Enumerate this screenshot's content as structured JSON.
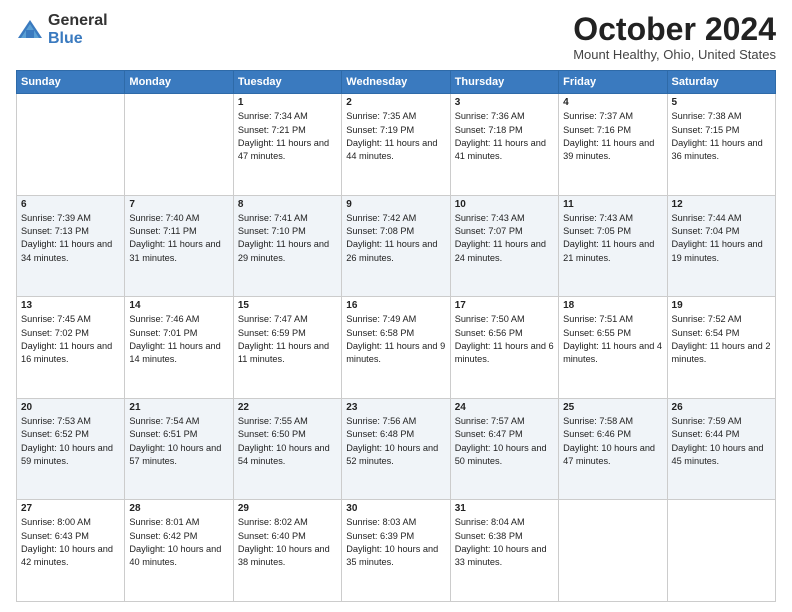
{
  "header": {
    "logo_general": "General",
    "logo_blue": "Blue",
    "title": "October 2024",
    "subtitle": "Mount Healthy, Ohio, United States"
  },
  "columns": [
    "Sunday",
    "Monday",
    "Tuesday",
    "Wednesday",
    "Thursday",
    "Friday",
    "Saturday"
  ],
  "weeks": [
    [
      {
        "day": "",
        "info": ""
      },
      {
        "day": "",
        "info": ""
      },
      {
        "day": "1",
        "info": "Sunrise: 7:34 AM\nSunset: 7:21 PM\nDaylight: 11 hours and 47 minutes."
      },
      {
        "day": "2",
        "info": "Sunrise: 7:35 AM\nSunset: 7:19 PM\nDaylight: 11 hours and 44 minutes."
      },
      {
        "day": "3",
        "info": "Sunrise: 7:36 AM\nSunset: 7:18 PM\nDaylight: 11 hours and 41 minutes."
      },
      {
        "day": "4",
        "info": "Sunrise: 7:37 AM\nSunset: 7:16 PM\nDaylight: 11 hours and 39 minutes."
      },
      {
        "day": "5",
        "info": "Sunrise: 7:38 AM\nSunset: 7:15 PM\nDaylight: 11 hours and 36 minutes."
      }
    ],
    [
      {
        "day": "6",
        "info": "Sunrise: 7:39 AM\nSunset: 7:13 PM\nDaylight: 11 hours and 34 minutes."
      },
      {
        "day": "7",
        "info": "Sunrise: 7:40 AM\nSunset: 7:11 PM\nDaylight: 11 hours and 31 minutes."
      },
      {
        "day": "8",
        "info": "Sunrise: 7:41 AM\nSunset: 7:10 PM\nDaylight: 11 hours and 29 minutes."
      },
      {
        "day": "9",
        "info": "Sunrise: 7:42 AM\nSunset: 7:08 PM\nDaylight: 11 hours and 26 minutes."
      },
      {
        "day": "10",
        "info": "Sunrise: 7:43 AM\nSunset: 7:07 PM\nDaylight: 11 hours and 24 minutes."
      },
      {
        "day": "11",
        "info": "Sunrise: 7:43 AM\nSunset: 7:05 PM\nDaylight: 11 hours and 21 minutes."
      },
      {
        "day": "12",
        "info": "Sunrise: 7:44 AM\nSunset: 7:04 PM\nDaylight: 11 hours and 19 minutes."
      }
    ],
    [
      {
        "day": "13",
        "info": "Sunrise: 7:45 AM\nSunset: 7:02 PM\nDaylight: 11 hours and 16 minutes."
      },
      {
        "day": "14",
        "info": "Sunrise: 7:46 AM\nSunset: 7:01 PM\nDaylight: 11 hours and 14 minutes."
      },
      {
        "day": "15",
        "info": "Sunrise: 7:47 AM\nSunset: 6:59 PM\nDaylight: 11 hours and 11 minutes."
      },
      {
        "day": "16",
        "info": "Sunrise: 7:49 AM\nSunset: 6:58 PM\nDaylight: 11 hours and 9 minutes."
      },
      {
        "day": "17",
        "info": "Sunrise: 7:50 AM\nSunset: 6:56 PM\nDaylight: 11 hours and 6 minutes."
      },
      {
        "day": "18",
        "info": "Sunrise: 7:51 AM\nSunset: 6:55 PM\nDaylight: 11 hours and 4 minutes."
      },
      {
        "day": "19",
        "info": "Sunrise: 7:52 AM\nSunset: 6:54 PM\nDaylight: 11 hours and 2 minutes."
      }
    ],
    [
      {
        "day": "20",
        "info": "Sunrise: 7:53 AM\nSunset: 6:52 PM\nDaylight: 10 hours and 59 minutes."
      },
      {
        "day": "21",
        "info": "Sunrise: 7:54 AM\nSunset: 6:51 PM\nDaylight: 10 hours and 57 minutes."
      },
      {
        "day": "22",
        "info": "Sunrise: 7:55 AM\nSunset: 6:50 PM\nDaylight: 10 hours and 54 minutes."
      },
      {
        "day": "23",
        "info": "Sunrise: 7:56 AM\nSunset: 6:48 PM\nDaylight: 10 hours and 52 minutes."
      },
      {
        "day": "24",
        "info": "Sunrise: 7:57 AM\nSunset: 6:47 PM\nDaylight: 10 hours and 50 minutes."
      },
      {
        "day": "25",
        "info": "Sunrise: 7:58 AM\nSunset: 6:46 PM\nDaylight: 10 hours and 47 minutes."
      },
      {
        "day": "26",
        "info": "Sunrise: 7:59 AM\nSunset: 6:44 PM\nDaylight: 10 hours and 45 minutes."
      }
    ],
    [
      {
        "day": "27",
        "info": "Sunrise: 8:00 AM\nSunset: 6:43 PM\nDaylight: 10 hours and 42 minutes."
      },
      {
        "day": "28",
        "info": "Sunrise: 8:01 AM\nSunset: 6:42 PM\nDaylight: 10 hours and 40 minutes."
      },
      {
        "day": "29",
        "info": "Sunrise: 8:02 AM\nSunset: 6:40 PM\nDaylight: 10 hours and 38 minutes."
      },
      {
        "day": "30",
        "info": "Sunrise: 8:03 AM\nSunset: 6:39 PM\nDaylight: 10 hours and 35 minutes."
      },
      {
        "day": "31",
        "info": "Sunrise: 8:04 AM\nSunset: 6:38 PM\nDaylight: 10 hours and 33 minutes."
      },
      {
        "day": "",
        "info": ""
      },
      {
        "day": "",
        "info": ""
      }
    ]
  ]
}
